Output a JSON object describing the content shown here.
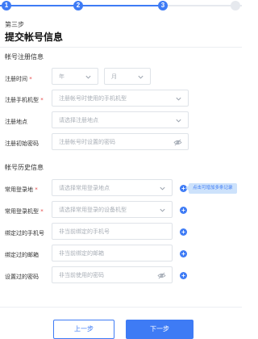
{
  "stepper": {
    "steps": [
      {
        "label": "1",
        "state": "done"
      },
      {
        "label": "2",
        "state": "done"
      },
      {
        "label": "3",
        "state": "current"
      },
      {
        "label": "",
        "state": "future"
      }
    ],
    "active_color": "#3e7bf5",
    "inactive_color": "#e6e9ee"
  },
  "header": {
    "step_no": "第三步",
    "title": "提交帐号信息"
  },
  "registration": {
    "title": "帐号注册信息",
    "reg_time": {
      "label": "注册时间",
      "required": "*",
      "year_placeholder": "年",
      "month_placeholder": "月"
    },
    "reg_phone": {
      "label": "注册手机机型",
      "required": "*",
      "placeholder": "注册帐号时使用的手机机型"
    },
    "reg_location": {
      "label": "注册地点",
      "placeholder": "请选择注册地点"
    },
    "initial_password": {
      "label": "注册初始密码",
      "placeholder": "注册帐号时设置的密码"
    }
  },
  "history": {
    "title": "帐号历史信息",
    "login_location": {
      "label": "常用登录地",
      "required": "*",
      "placeholder": "请选择常用登录地点",
      "tooltip": "点击可增加多条记录"
    },
    "login_device": {
      "label": "常用登录机型",
      "required": "*",
      "placeholder": "请选择常用登录的设备机型"
    },
    "bound_phone": {
      "label": "绑定过的手机号",
      "placeholder": "非当前绑定的手机号"
    },
    "bound_email": {
      "label": "绑定过的邮箱",
      "placeholder": "非当前绑定的邮箱"
    },
    "used_password": {
      "label": "设置过的密码",
      "placeholder": "非当前使用的密码"
    }
  },
  "footer": {
    "prev_label": "上一步",
    "next_label": "下一步"
  }
}
